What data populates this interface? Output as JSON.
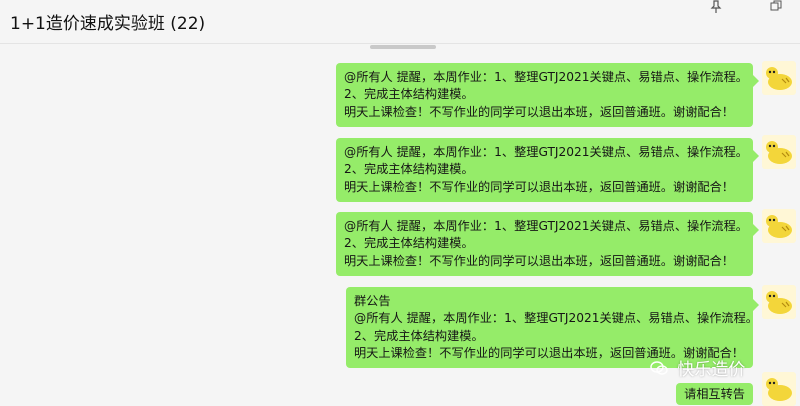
{
  "window": {
    "title": "1+1造价速成实验班 (22)"
  },
  "controls": {
    "pin_icon": "pin-icon",
    "restore_icon": "restore-icon"
  },
  "messages": [
    {
      "lines": [
        "@所有人 提醒，本周作业：1、整理GTJ2021关键点、易错点、操作流程。",
        "2、完成主体结构建模。",
        "明天上课检查！不写作业的同学可以退出本班，返回普通班。谢谢配合！"
      ]
    },
    {
      "lines": [
        "@所有人 提醒，本周作业：1、整理GTJ2021关键点、易错点、操作流程。",
        "2、完成主体结构建模。",
        "明天上课检查！不写作业的同学可以退出本班，返回普通班。谢谢配合！"
      ]
    },
    {
      "lines": [
        "@所有人 提醒，本周作业：1、整理GTJ2021关键点、易错点、操作流程。",
        "2、完成主体结构建模。",
        "明天上课检查！不写作业的同学可以退出本班，返回普通班。谢谢配合！"
      ]
    },
    {
      "lines": [
        "群公告",
        "@所有人 提醒，本周作业：1、整理GTJ2021关键点、易错点、操作流程。",
        "2、完成主体结构建模。",
        "明天上课检查！不写作业的同学可以退出本班，返回普通班。谢谢配合！"
      ]
    },
    {
      "lines": [
        "请相互转告"
      ]
    }
  ],
  "watermark": {
    "text": "快乐造价"
  },
  "colors": {
    "bubble": "#95ec69",
    "background": "#f5f5f5"
  }
}
